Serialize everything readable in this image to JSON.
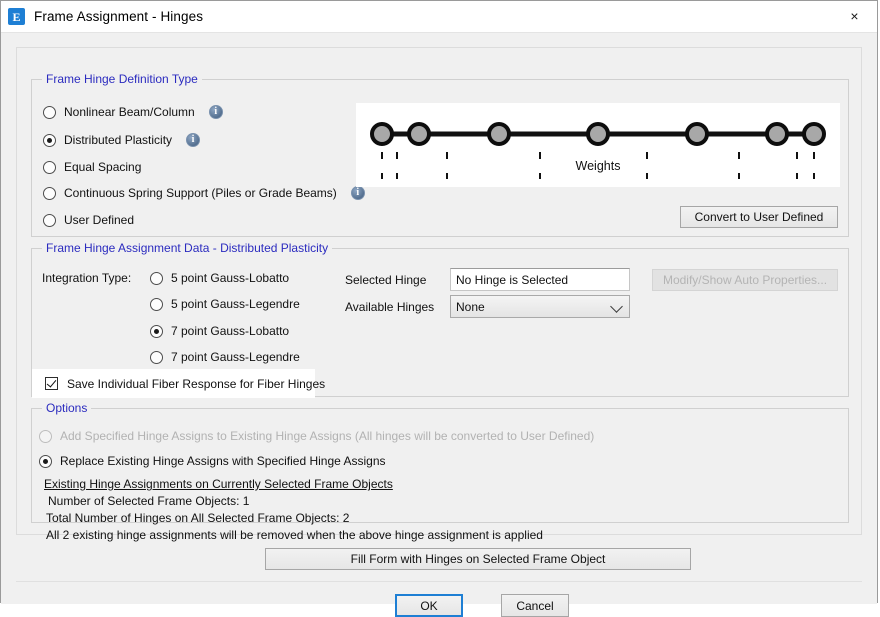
{
  "window": {
    "title": "Frame Assignment - Hinges",
    "icon": "E",
    "close_label": "×"
  },
  "definition_type": {
    "group_title": "Frame Hinge Definition Type",
    "options": [
      {
        "label": "Nonlinear Beam/Column",
        "checked": false,
        "info": true
      },
      {
        "label": "Distributed Plasticity",
        "checked": true,
        "info": true
      },
      {
        "label": "Equal Spacing",
        "checked": false,
        "info": false
      },
      {
        "label": "Continuous Spring Support (Piles or Grade Beams)",
        "checked": false,
        "info": true
      },
      {
        "label": "User Defined",
        "checked": false,
        "info": false
      }
    ],
    "info_glyph": "i",
    "convert_button": "Convert to User Defined"
  },
  "diagram": {
    "caption": "Weights",
    "node_count": 7,
    "node_positions_pct": [
      1.5,
      8.5,
      23.5,
      50,
      76.5,
      91.5,
      98.5
    ],
    "tick_positions_pct": [
      1.5,
      8.5,
      23.5,
      50,
      76.5,
      91.5,
      98.5
    ]
  },
  "assignment_data": {
    "group_title": "Frame Hinge Assignment Data - Distributed Plasticity",
    "integration_type_label": "Integration Type:",
    "integration_options": [
      {
        "label": "5 point Gauss-Lobatto",
        "checked": false
      },
      {
        "label": "5 point Gauss-Legendre",
        "checked": false
      },
      {
        "label": "7 point Gauss-Lobatto",
        "checked": true
      },
      {
        "label": "7 point Gauss-Legendre",
        "checked": false
      }
    ],
    "selected_hinge_label": "Selected Hinge",
    "selected_hinge_value": "No Hinge is Selected",
    "available_hinges_label": "Available Hinges",
    "available_hinges_value": "None",
    "modify_show_button": "Modify/Show Auto Properties...",
    "fiber_checkbox_label": "Save Individual Fiber Response for Fiber Hinges",
    "fiber_checkbox_checked": true
  },
  "options": {
    "group_title": "Options",
    "add_specified_label": "Add Specified Hinge Assigns to Existing Hinge Assigns (All hinges will be converted to User Defined)",
    "add_specified_checked": false,
    "add_specified_disabled": true,
    "replace_existing_label": "Replace Existing Hinge Assigns with Specified Hinge Assigns",
    "replace_existing_checked": true,
    "existing_heading": "Existing Hinge Assignments on Currently Selected Frame Objects",
    "line_number_selected": "Number of Selected Frame Objects: 1",
    "line_total_hinges": "Total Number of Hinges on All Selected Frame Objects: 2",
    "line_removal_note": "All 2 existing hinge assignments will be removed when the above hinge assignment is applied",
    "fill_form_button": "Fill Form with Hinges on Selected Frame Object"
  },
  "footer": {
    "ok_label": "OK",
    "cancel_label": "Cancel"
  }
}
